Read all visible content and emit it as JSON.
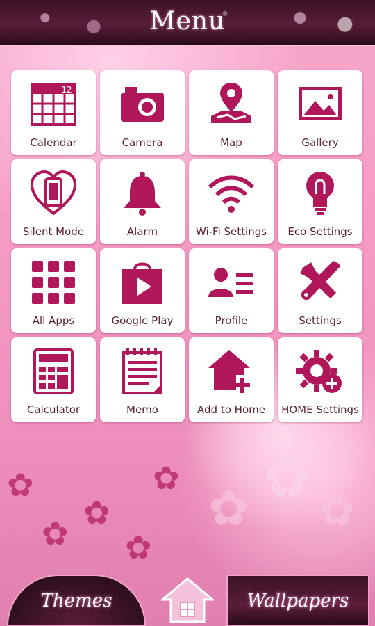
{
  "header": {
    "title": "Menu"
  },
  "tiles": [
    {
      "label": "Calendar",
      "icon": "calendar-icon",
      "badge": "12"
    },
    {
      "label": "Camera",
      "icon": "camera-icon"
    },
    {
      "label": "Map",
      "icon": "map-icon"
    },
    {
      "label": "Gallery",
      "icon": "gallery-icon"
    },
    {
      "label": "Silent Mode",
      "icon": "silent-mode-icon"
    },
    {
      "label": "Alarm",
      "icon": "bell-icon"
    },
    {
      "label": "Wi-Fi Settings",
      "icon": "wifi-icon"
    },
    {
      "label": "Eco Settings",
      "icon": "lightbulb-icon"
    },
    {
      "label": "All Apps",
      "icon": "apps-grid-icon"
    },
    {
      "label": "Google Play",
      "icon": "play-store-icon"
    },
    {
      "label": "Profile",
      "icon": "profile-icon"
    },
    {
      "label": "Settings",
      "icon": "tools-icon"
    },
    {
      "label": "Calculator",
      "icon": "calculator-icon"
    },
    {
      "label": "Memo",
      "icon": "memo-icon"
    },
    {
      "label": "Add to Home",
      "icon": "add-home-icon"
    },
    {
      "label": "HOME Settings",
      "icon": "gear-plus-icon"
    }
  ],
  "bottom": {
    "themes_label": "Themes",
    "wallpapers_label": "Wallpapers"
  },
  "colors": {
    "accent": "#b0175a",
    "header_bg": "#3b1325",
    "tile_bg": "#ffffff"
  }
}
